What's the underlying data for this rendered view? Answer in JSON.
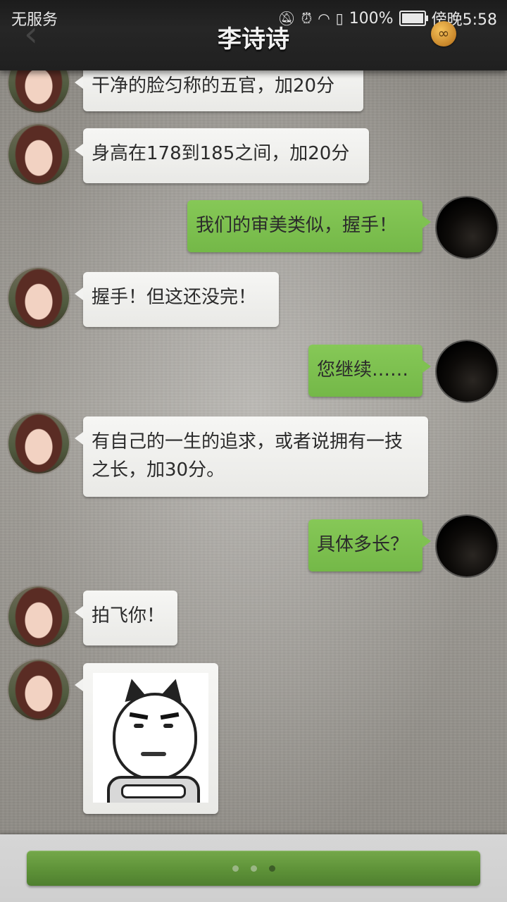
{
  "status_bar": {
    "carrier": "无服务",
    "battery_percent": "100%",
    "battery_level": 1.0,
    "time": "傍晚5:58",
    "icons": [
      "mute-icon",
      "alarm-icon",
      "wifi-icon",
      "sim-icon",
      "battery-icon"
    ]
  },
  "header": {
    "title": "李诗诗",
    "back_icon": "chevron-left-icon",
    "badge_icon": "infinity-badge-icon",
    "badge_glyph": "∞"
  },
  "messages": [
    {
      "side": "left",
      "text": "干净的脸匀称的五官，加20分"
    },
    {
      "side": "left",
      "text": "身高在178到185之间，加20分"
    },
    {
      "side": "right",
      "text": "我们的审美类似，握手！"
    },
    {
      "side": "left",
      "text": "握手！但这还没完！"
    },
    {
      "side": "right",
      "text": "您继续……"
    },
    {
      "side": "left",
      "text": "有自己的一生的追求，或者说拥有一技之长，加30分。"
    },
    {
      "side": "right",
      "text": "具体多长？"
    },
    {
      "side": "left",
      "text": "拍飞你！"
    },
    {
      "side": "left",
      "type": "sticker",
      "sticker": "smug-cat-face-sticker"
    }
  ],
  "footer": {
    "typing_indicator_dots": 3,
    "active_dot": 3
  },
  "colors": {
    "left_bubble": "#f0f0ee",
    "right_bubble": "#7fc151",
    "continue_bar": "#5e9238",
    "topbar": "#222222"
  }
}
